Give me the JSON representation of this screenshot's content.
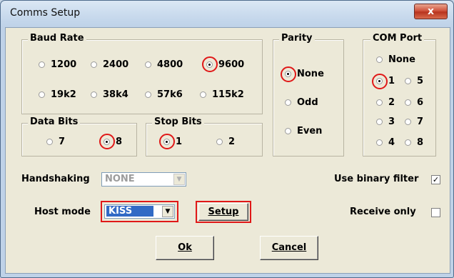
{
  "window": {
    "title": "Comms Setup",
    "close_glyph": "x"
  },
  "baud_rate": {
    "label": "Baud Rate",
    "options": [
      "1200",
      "2400",
      "4800",
      "9600",
      "19k2",
      "38k4",
      "57k6",
      "115k2"
    ],
    "selected": "9600"
  },
  "parity": {
    "label": "Parity",
    "options": [
      "None",
      "Odd",
      "Even"
    ],
    "selected": "None"
  },
  "com_port": {
    "label": "COM Port",
    "options": [
      "None",
      "1",
      "5",
      "2",
      "6",
      "3",
      "7",
      "4",
      "8"
    ],
    "selected": "1"
  },
  "data_bits": {
    "label": "Data Bits",
    "options": [
      "7",
      "8"
    ],
    "selected": "8"
  },
  "stop_bits": {
    "label": "Stop Bits",
    "options": [
      "1",
      "2"
    ],
    "selected": "1"
  },
  "handshaking": {
    "label": "Handshaking",
    "value": "NONE"
  },
  "host_mode": {
    "label": "Host mode",
    "value": "KISS"
  },
  "setup_button": {
    "label": "Setup"
  },
  "binary_filter": {
    "label": "Use binary filter",
    "checked": true,
    "mark": "✓"
  },
  "receive_only": {
    "label": "Receive only",
    "checked": false
  },
  "buttons": {
    "ok": "Ok",
    "cancel": "Cancel"
  },
  "colors": {
    "highlight": "#e01818",
    "selection": "#316ac5",
    "face": "#ece9d8"
  }
}
